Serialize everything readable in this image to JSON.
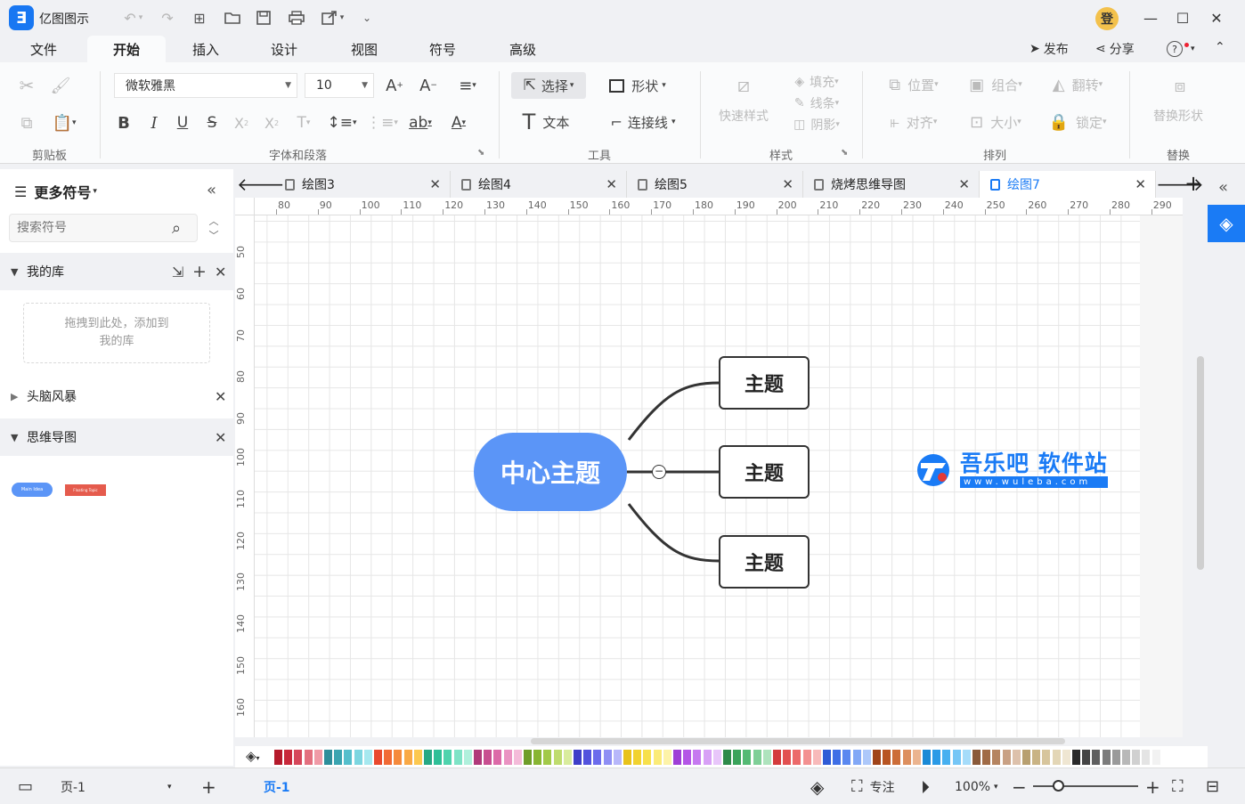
{
  "app": {
    "title": "亿图图示",
    "logo": "Ǝ",
    "user_avatar": "登"
  },
  "menu_tabs": [
    "文件",
    "开始",
    "插入",
    "设计",
    "视图",
    "符号",
    "高级"
  ],
  "menu_right": {
    "publish": "发布",
    "share": "分享",
    "help": "?"
  },
  "ribbon": {
    "groups": {
      "clipboard": "剪贴板",
      "font": "字体和段落",
      "tools": "工具",
      "style": "样式",
      "arrange": "排列",
      "replace": "替换"
    },
    "font_name": "微软雅黑",
    "font_size": "10",
    "tools": {
      "select": "选择",
      "shape": "形状",
      "text": "文本",
      "connector": "连接线"
    },
    "style": {
      "quick": "快速样式",
      "fill": "填充",
      "line": "线条",
      "shadow": "阴影"
    },
    "arrange": {
      "position": "位置",
      "group": "组合",
      "flip": "翻转",
      "align": "对齐",
      "size": "大小",
      "lock": "锁定"
    },
    "replace_shape": "替换形状"
  },
  "left_panel": {
    "title": "更多符号",
    "search_placeholder": "搜索符号",
    "sections": {
      "my_lib": "我的库",
      "brainstorm": "头脑风暴",
      "mindmap": "思维导图"
    },
    "drop_hint": "拖拽到此处，添加到我的库",
    "thumb_main": "Main Idea",
    "thumb_float": "Floating Topic"
  },
  "doc_tabs": [
    {
      "label": "绘图3"
    },
    {
      "label": "绘图4"
    },
    {
      "label": "绘图5"
    },
    {
      "label": "烧烤思维导图"
    },
    {
      "label": "绘图7"
    }
  ],
  "ruler": {
    "h": [
      "80",
      "90",
      "100",
      "110",
      "120",
      "130",
      "140",
      "150",
      "160",
      "170",
      "180",
      "190",
      "200",
      "210",
      "220",
      "230",
      "240",
      "250",
      "260",
      "270",
      "280",
      "290"
    ],
    "v": [
      "50",
      "60",
      "70",
      "80",
      "90",
      "100",
      "110",
      "120",
      "130",
      "140",
      "150",
      "160"
    ]
  },
  "mindmap": {
    "center": "中心主题",
    "topics": [
      "主题",
      "主题",
      "主题"
    ],
    "collapse": "−"
  },
  "watermark": {
    "name": "吾乐吧 软件站",
    "url": "www.wuleba.com"
  },
  "palette": [
    "#b51a2b",
    "#c8283a",
    "#d6475a",
    "#e3707f",
    "#f09aa6",
    "#2e8e9a",
    "#3aa4b0",
    "#55bfcc",
    "#7dd6e0",
    "#a6e8ef",
    "#e94a2e",
    "#f16a35",
    "#f58a3c",
    "#f9a946",
    "#fcc84f",
    "#27a884",
    "#2fbf97",
    "#4fd3ad",
    "#7fe3c6",
    "#b0f0dc",
    "#b03a7a",
    "#c84e90",
    "#dc6aa8",
    "#ea93c2",
    "#f4bbd9",
    "#6f9d2a",
    "#88b533",
    "#a2c948",
    "#bfdc6e",
    "#d9ec9d",
    "#3f3fc8",
    "#5353dd",
    "#6c6cec",
    "#8f8ff4",
    "#b7b7fa",
    "#e8c21a",
    "#f1d22f",
    "#f7e04b",
    "#fbeb78",
    "#fdf3a8",
    "#9f3fd6",
    "#b456e6",
    "#c679f0",
    "#d8a0f6",
    "#e8c6fa",
    "#2e8a4a",
    "#3aa35a",
    "#55ba74",
    "#7fcf97",
    "#aee3bd",
    "#d43c3c",
    "#e25050",
    "#ec6a6a",
    "#f39191",
    "#f8baba",
    "#2f5bd6",
    "#3f6fe6",
    "#5a88f0",
    "#82a8f6",
    "#adc8fa",
    "#a0441a",
    "#b85522",
    "#cc6d38",
    "#dd8f5e",
    "#ebb48f",
    "#1b8ad6",
    "#2a9ae6",
    "#47b0f0",
    "#75c6f6",
    "#a5dcfa",
    "#8a5a3a",
    "#a06b46",
    "#b58460",
    "#c9a184",
    "#ddc1ab",
    "#b8a070",
    "#c9b384",
    "#d7c59c",
    "#e3d6b6",
    "#efe6d2",
    "#2a2a2a",
    "#444444",
    "#5f5f5f",
    "#7c7c7c",
    "#9a9a9a",
    "#b8b8b8",
    "#d0d0d0",
    "#e4e4e4",
    "#f2f2f2"
  ],
  "status": {
    "page_name": "页-1",
    "page_tab": "页-1",
    "focus": "专注",
    "zoom": "100%"
  },
  "colors": {
    "accent": "#1a7bf5",
    "center_topic": "#5b95f7",
    "topic_border": "#333333"
  }
}
